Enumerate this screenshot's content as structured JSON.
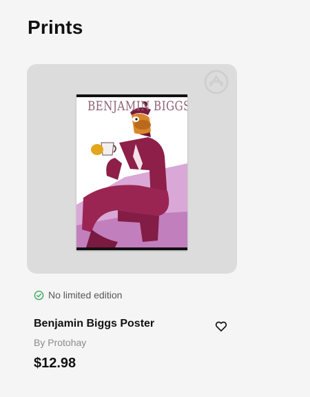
{
  "section": {
    "title": "Prints"
  },
  "product": {
    "poster_text": "BENJAMIN BIGGS",
    "edition_label": "No limited edition",
    "name": "Benjamin Biggs Poster",
    "author": "By Protohay",
    "price": "$12.98"
  },
  "colors": {
    "background": "#f5f5f5",
    "card_background": "#dcdcdc",
    "check_green": "#3aa65a",
    "poster_title": "#8f6173",
    "suit": "#8e1f49"
  },
  "icons": {
    "edition": "check-circle-icon",
    "favorite": "heart-outline-icon",
    "badge": "brand-logo-icon"
  }
}
